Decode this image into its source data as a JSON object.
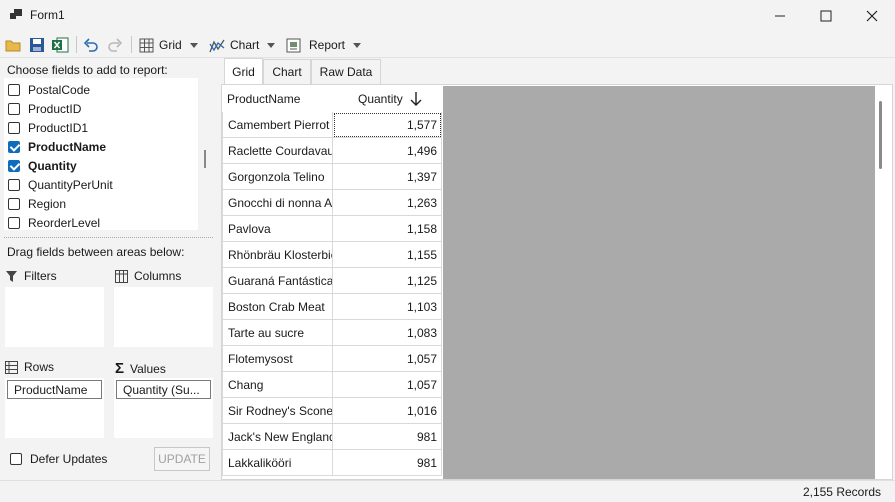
{
  "window": {
    "title": "Form1"
  },
  "toolbar": {
    "grid_label": "Grid",
    "chart_label": "Chart",
    "report_label": "Report"
  },
  "left": {
    "choose_label": "Choose fields to add to report:",
    "fields": [
      {
        "label": "PostalCode",
        "checked": false
      },
      {
        "label": "ProductID",
        "checked": false
      },
      {
        "label": "ProductID1",
        "checked": false
      },
      {
        "label": "ProductName",
        "checked": true
      },
      {
        "label": "Quantity",
        "checked": true
      },
      {
        "label": "QuantityPerUnit",
        "checked": false
      },
      {
        "label": "Region",
        "checked": false
      },
      {
        "label": "ReorderLevel",
        "checked": false
      }
    ],
    "drag_label": "Drag fields between areas below:",
    "filters_label": "Filters",
    "columns_label": "Columns",
    "rows_label": "Rows",
    "values_label": "Values",
    "rows_chip": "ProductName",
    "values_chip": "Quantity (Su...",
    "defer_label": "Defer Updates",
    "update_label": "UPDATE"
  },
  "tabs": [
    "Grid",
    "Chart",
    "Raw Data"
  ],
  "grid": {
    "headers": [
      "ProductName",
      "Quantity"
    ],
    "rows": [
      [
        "Camembert Pierrot",
        "1,577"
      ],
      [
        "Raclette Courdavault",
        "1,496"
      ],
      [
        "Gorgonzola Telino",
        "1,397"
      ],
      [
        "Gnocchi di nonna Alice",
        "1,263"
      ],
      [
        "Pavlova",
        "1,158"
      ],
      [
        "Rhönbräu Klosterbier",
        "1,155"
      ],
      [
        "Guaraná Fantástica",
        "1,125"
      ],
      [
        "Boston Crab Meat",
        "1,103"
      ],
      [
        "Tarte au sucre",
        "1,083"
      ],
      [
        "Flotemysost",
        "1,057"
      ],
      [
        "Chang",
        "1,057"
      ],
      [
        "Sir Rodney's Scones",
        "1,016"
      ],
      [
        "Jack's New England",
        "981"
      ],
      [
        "Lakkalikööri",
        "981"
      ]
    ]
  },
  "status": {
    "records": "2,155 Records"
  }
}
